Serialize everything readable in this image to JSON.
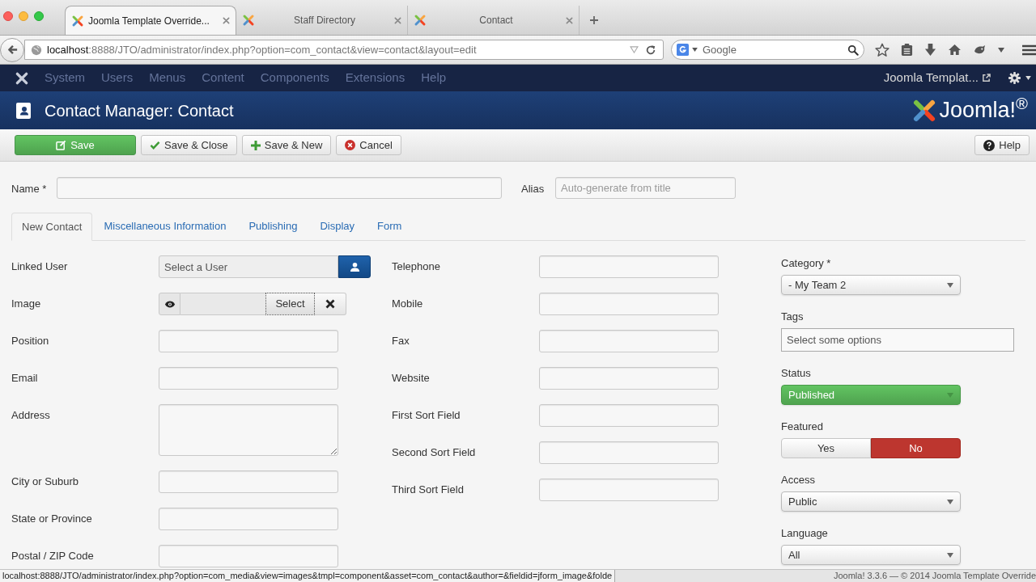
{
  "browser": {
    "tabs": [
      {
        "title": "Joomla Template Override...",
        "selected": true
      },
      {
        "title": "Staff Directory",
        "selected": false
      },
      {
        "title": "Contact",
        "selected": false
      }
    ],
    "address": {
      "host": "localhost",
      "path": ":8888/JTO/administrator/index.php?option=com_contact&view=contact&layout=edit"
    },
    "search": {
      "placeholder": "Google"
    }
  },
  "admin_menu": {
    "items": [
      {
        "label": "System",
        "disabled": true
      },
      {
        "label": "Users",
        "disabled": true
      },
      {
        "label": "Menus",
        "disabled": true
      },
      {
        "label": "Content",
        "disabled": true
      },
      {
        "label": "Components",
        "disabled": true
      },
      {
        "label": "Extensions",
        "disabled": true
      },
      {
        "label": "Help",
        "disabled": true
      }
    ],
    "site_link": "Joomla Templat..."
  },
  "header": {
    "title": "Contact Manager: Contact",
    "logo_text": "Joomla!$^{®}$"
  },
  "toolbar": {
    "buttons": [
      {
        "label": "Save",
        "kind": "save"
      },
      {
        "label": "Save & Close",
        "kind": "save_close"
      },
      {
        "label": "Save & New",
        "kind": "save_new"
      },
      {
        "label": "Cancel",
        "kind": "cancel"
      }
    ],
    "help": "Help"
  },
  "title_fields": [
    {
      "label": "Name *"
    },
    {
      "label": "Alias",
      "placeholder": "Auto-generate from title"
    }
  ],
  "tabs": [
    {
      "label": "New Contact",
      "selected": true
    },
    {
      "label": "Miscellaneous Information",
      "selected": false
    },
    {
      "label": "Publishing",
      "selected": false
    },
    {
      "label": "Display",
      "selected": false
    },
    {
      "label": "Form",
      "selected": false
    }
  ],
  "details": {
    "column_1": [
      {
        "label": "Linked User",
        "kind": "user",
        "value": "Select a User"
      },
      {
        "label": "Image",
        "kind": "image",
        "button": "Select"
      },
      {
        "label": "Position",
        "kind": "text"
      },
      {
        "label": "Email",
        "kind": "text"
      },
      {
        "label": "Address",
        "kind": "textarea"
      },
      {
        "label": "City or Suburb",
        "kind": "text"
      },
      {
        "label": "State or Province",
        "kind": "text"
      },
      {
        "label": "Postal / ZIP Code",
        "kind": "text"
      }
    ],
    "column_2": [
      {
        "label": "Telephone",
        "kind": "text"
      },
      {
        "label": "Mobile",
        "kind": "text"
      },
      {
        "label": "Fax",
        "kind": "text"
      },
      {
        "label": "Website",
        "kind": "text"
      },
      {
        "label": "First Sort Field",
        "kind": "text"
      },
      {
        "label": "Second Sort Field",
        "kind": "text"
      },
      {
        "label": "Third Sort Field",
        "kind": "text"
      }
    ]
  },
  "options": [
    {
      "label": "Category *",
      "kind": "select",
      "value": "- My Team 2"
    },
    {
      "label": "Tags",
      "kind": "tags",
      "placeholder": "Select some options"
    },
    {
      "label": "Status",
      "kind": "status",
      "value": "Published"
    },
    {
      "label": "Featured",
      "kind": "toggle",
      "options": [
        {
          "label": "Yes",
          "selected": false
        },
        {
          "label": "No",
          "selected": true
        }
      ]
    },
    {
      "label": "Access",
      "kind": "select",
      "value": "Public"
    },
    {
      "label": "Language",
      "kind": "select",
      "value": "All"
    }
  ],
  "status_bar": {
    "link_preview": "localhost:8888/JTO/administrator/index.php?option=com_media&view=images&tmpl=component&asset=com_contact&author=&fieldid=jform_image&folde",
    "footer": "Joomla! 3.3.6 — © 2014 Joomla Template Override"
  }
}
